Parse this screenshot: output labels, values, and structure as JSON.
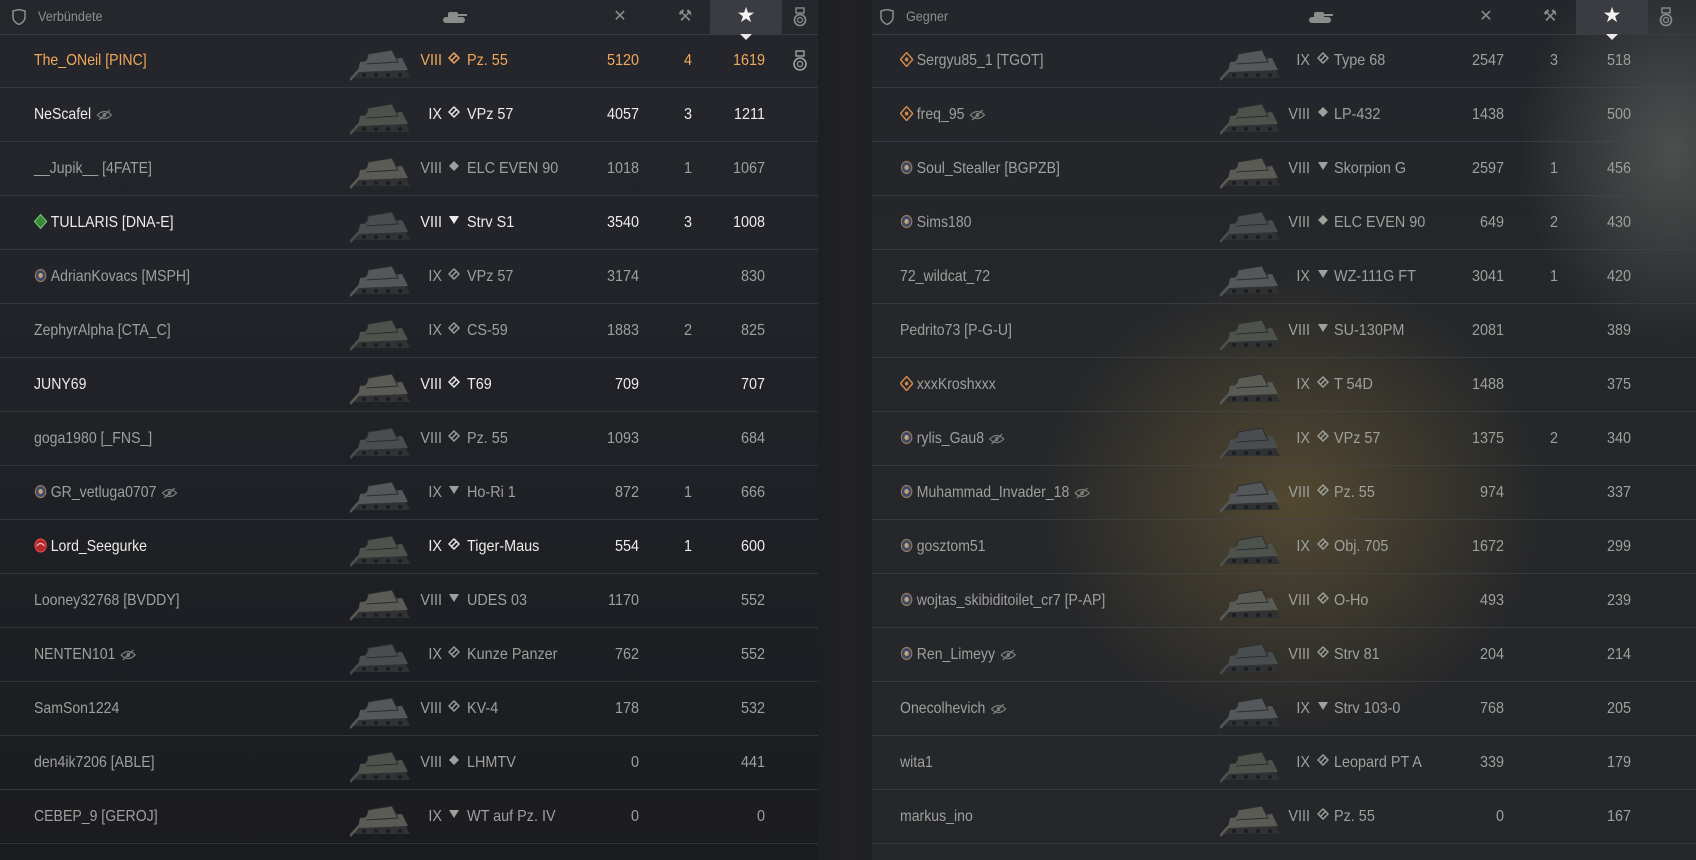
{
  "allies": {
    "title": "Verbündete",
    "header_icons": [
      "shield-icon",
      "tank-icon",
      "damage-icon",
      "assist-icon",
      "star-icon",
      "medal-icon"
    ],
    "rows": [
      {
        "name": "The_ONeil [PINC]",
        "style": "gold",
        "badge": "",
        "hidden": false,
        "tier": "VIII",
        "cls": "medium",
        "vehicle": "Pz. 55",
        "damage": "5120",
        "kills": "4",
        "xp": "1619",
        "medal": true
      },
      {
        "name": "NeScafel",
        "style": "bright",
        "badge": "",
        "hidden": true,
        "tier": "IX",
        "cls": "medium",
        "vehicle": "VPz 57",
        "damage": "4057",
        "kills": "3",
        "xp": "1211",
        "medal": false
      },
      {
        "name": "__Jupik__ [4FATE]",
        "style": "dim",
        "badge": "",
        "hidden": false,
        "tier": "VIII",
        "cls": "light",
        "vehicle": "ELC EVEN 90",
        "damage": "1018",
        "kills": "1",
        "xp": "1067",
        "medal": false
      },
      {
        "name": "TULLARIS [DNA-E]",
        "style": "bright",
        "badge": "green-diamond",
        "hidden": false,
        "tier": "VIII",
        "cls": "td",
        "vehicle": "Strv S1",
        "damage": "3540",
        "kills": "3",
        "xp": "1008",
        "medal": false
      },
      {
        "name": "AdrianKovacs [MSPH]",
        "style": "dim",
        "badge": "emblem",
        "hidden": false,
        "tier": "IX",
        "cls": "medium",
        "vehicle": "VPz 57",
        "damage": "3174",
        "kills": "",
        "xp": "830",
        "medal": false
      },
      {
        "name": "ZephyrAlpha [CTA_C]",
        "style": "dim",
        "badge": "",
        "hidden": false,
        "tier": "IX",
        "cls": "medium",
        "vehicle": "CS-59",
        "damage": "1883",
        "kills": "2",
        "xp": "825",
        "medal": false
      },
      {
        "name": "JUNY69",
        "style": "bright",
        "badge": "",
        "hidden": false,
        "tier": "VIII",
        "cls": "medium",
        "vehicle": "T69",
        "damage": "709",
        "kills": "",
        "xp": "707",
        "medal": false
      },
      {
        "name": "goga1980 [_FNS_]",
        "style": "dim",
        "badge": "",
        "hidden": false,
        "tier": "VIII",
        "cls": "medium",
        "vehicle": "Pz. 55",
        "damage": "1093",
        "kills": "",
        "xp": "684",
        "medal": false
      },
      {
        "name": "GR_vetluga0707",
        "style": "dim",
        "badge": "emblem",
        "hidden": true,
        "tier": "IX",
        "cls": "td",
        "vehicle": "Ho-Ri 1",
        "damage": "872",
        "kills": "1",
        "xp": "666",
        "medal": false
      },
      {
        "name": "Lord_Seegurke",
        "style": "bright",
        "badge": "red-emblem",
        "hidden": false,
        "tier": "IX",
        "cls": "medium",
        "vehicle": "Tiger-Maus",
        "damage": "554",
        "kills": "1",
        "xp": "600",
        "medal": false
      },
      {
        "name": "Looney32768 [BVDDY]",
        "style": "dim",
        "badge": "",
        "hidden": false,
        "tier": "VIII",
        "cls": "td",
        "vehicle": "UDES 03",
        "damage": "1170",
        "kills": "",
        "xp": "552",
        "medal": false
      },
      {
        "name": "NENTEN101",
        "style": "dim",
        "badge": "",
        "hidden": true,
        "tier": "IX",
        "cls": "medium",
        "vehicle": "Kunze Panzer",
        "damage": "762",
        "kills": "",
        "xp": "552",
        "medal": false
      },
      {
        "name": "SamSon1224",
        "style": "dim",
        "badge": "",
        "hidden": false,
        "tier": "VIII",
        "cls": "medium",
        "vehicle": "KV-4",
        "damage": "178",
        "kills": "",
        "xp": "532",
        "medal": false
      },
      {
        "name": "den4ik7206 [ABLE]",
        "style": "dim",
        "badge": "",
        "hidden": false,
        "tier": "VIII",
        "cls": "light",
        "vehicle": "LHMTV",
        "damage": "0",
        "kills": "",
        "xp": "441",
        "medal": false
      },
      {
        "name": "CEBEP_9 [GEROJ]",
        "style": "dim",
        "badge": "",
        "hidden": false,
        "tier": "IX",
        "cls": "td",
        "vehicle": "WT auf Pz. IV",
        "damage": "0",
        "kills": "",
        "xp": "0",
        "medal": false
      }
    ]
  },
  "enemies": {
    "title": "Gegner",
    "header_icons": [
      "shield-icon",
      "tank-icon",
      "damage-icon",
      "assist-icon",
      "star-icon",
      "medal-icon"
    ],
    "rows": [
      {
        "name": "Sergyu85_1 [TGOT]",
        "style": "dim",
        "badge": "orange-diamond",
        "hidden": false,
        "tier": "IX",
        "cls": "medium",
        "vehicle": "Type 68",
        "damage": "2547",
        "kills": "3",
        "xp": "518"
      },
      {
        "name": "freq_95",
        "style": "dim",
        "badge": "orange-diamond",
        "hidden": true,
        "tier": "VIII",
        "cls": "light",
        "vehicle": "LP-432",
        "damage": "1438",
        "kills": "",
        "xp": "500"
      },
      {
        "name": "Soul_Stealler [BGPZB]",
        "style": "dim",
        "badge": "emblem",
        "hidden": false,
        "tier": "VIII",
        "cls": "td",
        "vehicle": "Skorpion G",
        "damage": "2597",
        "kills": "1",
        "xp": "456"
      },
      {
        "name": "Sims180",
        "style": "dim",
        "badge": "emblem",
        "hidden": false,
        "tier": "VIII",
        "cls": "light",
        "vehicle": "ELC EVEN 90",
        "damage": "649",
        "kills": "2",
        "xp": "430"
      },
      {
        "name": "72_wildcat_72",
        "style": "dim",
        "badge": "",
        "hidden": false,
        "tier": "IX",
        "cls": "td",
        "vehicle": "WZ-111G FT",
        "damage": "3041",
        "kills": "1",
        "xp": "420"
      },
      {
        "name": "Pedrito73 [P-G-U]",
        "style": "dim",
        "badge": "",
        "hidden": false,
        "tier": "VIII",
        "cls": "td",
        "vehicle": "SU-130PM",
        "damage": "2081",
        "kills": "",
        "xp": "389"
      },
      {
        "name": "xxxKroshxxx",
        "style": "dim",
        "badge": "orange-diamond",
        "hidden": false,
        "tier": "IX",
        "cls": "medium",
        "vehicle": "T 54D",
        "damage": "1488",
        "kills": "",
        "xp": "375"
      },
      {
        "name": "rylis_Gau8",
        "style": "dim",
        "badge": "emblem",
        "hidden": true,
        "tier": "IX",
        "cls": "medium",
        "vehicle": "VPz 57",
        "damage": "1375",
        "kills": "2",
        "xp": "340"
      },
      {
        "name": "Muhammad_Invader_18",
        "style": "dim",
        "badge": "emblem",
        "hidden": true,
        "tier": "VIII",
        "cls": "medium",
        "vehicle": "Pz. 55",
        "damage": "974",
        "kills": "",
        "xp": "337"
      },
      {
        "name": "gosztom51",
        "style": "dim",
        "badge": "emblem",
        "hidden": false,
        "tier": "IX",
        "cls": "medium",
        "vehicle": "Obj. 705",
        "damage": "1672",
        "kills": "",
        "xp": "299"
      },
      {
        "name": "wojtas_skibiditoilet_cr7 [P-AP]",
        "style": "dim",
        "badge": "emblem",
        "hidden": false,
        "tier": "VIII",
        "cls": "medium",
        "vehicle": "O-Ho",
        "damage": "493",
        "kills": "",
        "xp": "239"
      },
      {
        "name": "Ren_Limeyy",
        "style": "dim",
        "badge": "emblem",
        "hidden": true,
        "tier": "VIII",
        "cls": "medium",
        "vehicle": "Strv 81",
        "damage": "204",
        "kills": "",
        "xp": "214"
      },
      {
        "name": "Onecolhevich",
        "style": "dim",
        "badge": "",
        "hidden": true,
        "tier": "IX",
        "cls": "td",
        "vehicle": "Strv 103-0",
        "damage": "768",
        "kills": "",
        "xp": "205"
      },
      {
        "name": "wita1",
        "style": "dim",
        "badge": "",
        "hidden": false,
        "tier": "IX",
        "cls": "medium",
        "vehicle": "Leopard PT A",
        "damage": "339",
        "kills": "",
        "xp": "179"
      },
      {
        "name": "markus_ino",
        "style": "dim",
        "badge": "",
        "hidden": false,
        "tier": "VIII",
        "cls": "medium",
        "vehicle": "Pz. 55",
        "damage": "0",
        "kills": "",
        "xp": "167"
      }
    ]
  },
  "colors": {
    "gold": "#f0a85a",
    "bright": "#ecece8",
    "dim": "#9ea09c",
    "header_active": "#3a3c42"
  }
}
